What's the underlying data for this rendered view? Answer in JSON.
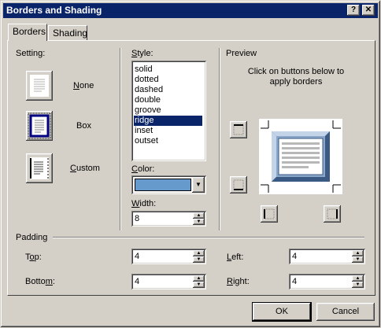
{
  "window": {
    "title": "Borders and Shading",
    "help_glyph": "?",
    "close_glyph": "✕"
  },
  "tabs": [
    {
      "label": "Borders",
      "active": true
    },
    {
      "label": "Shading",
      "active": false
    }
  ],
  "setting": {
    "heading": "Setting:",
    "options": [
      {
        "label": "None",
        "selected": false
      },
      {
        "label": "Box",
        "selected": true
      },
      {
        "label": "Custom",
        "selected": false
      }
    ]
  },
  "style": {
    "heading": "Style:",
    "options": [
      "solid",
      "dotted",
      "dashed",
      "double",
      "groove",
      "ridge",
      "inset",
      "outset"
    ],
    "selected": "ridge"
  },
  "color": {
    "label": "Color:",
    "value_color": "#6699cc"
  },
  "width": {
    "label": "Width:",
    "value": "8"
  },
  "preview": {
    "heading": "Preview",
    "instruction": "Click on buttons below to apply borders",
    "border_color": "#8aa6c8"
  },
  "padding": {
    "heading": "Padding",
    "top_label": "Top:",
    "top_value": "4",
    "bottom_label": "Bottom:",
    "bottom_value": "4",
    "left_label": "Left:",
    "left_value": "4",
    "right_label": "Right:",
    "right_value": "4"
  },
  "buttons": {
    "ok": "OK",
    "cancel": "Cancel"
  },
  "colors": {
    "titlebar": "#0a246a",
    "face": "#d4d0c8",
    "selection": "#0a246a"
  }
}
